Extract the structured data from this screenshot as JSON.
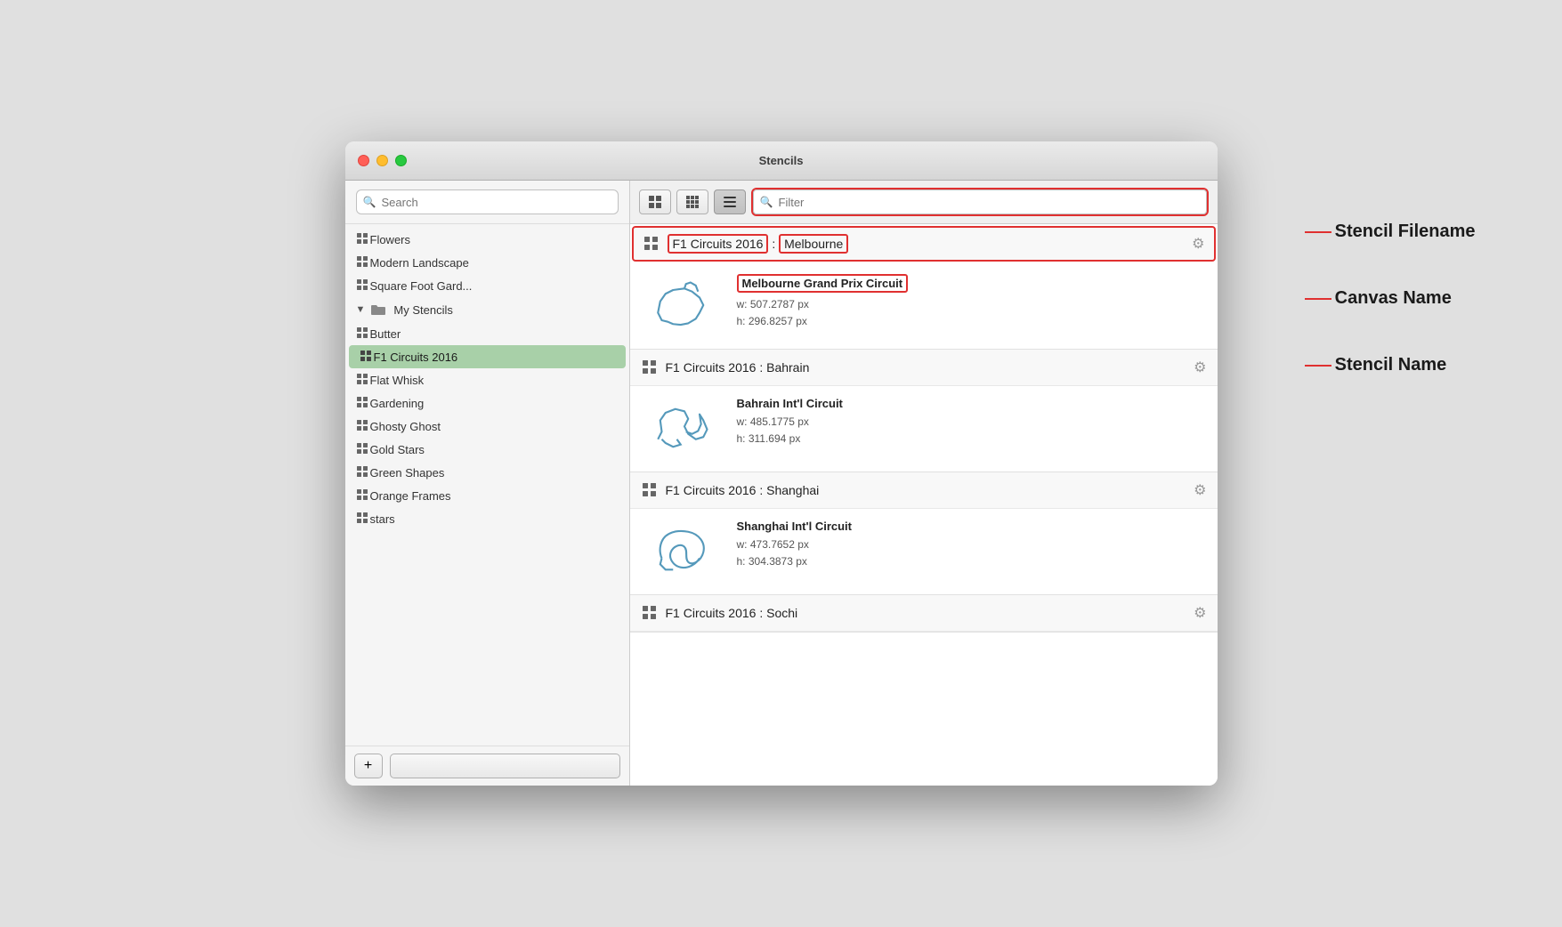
{
  "window": {
    "title": "Stencils"
  },
  "sidebar": {
    "search_placeholder": "Search",
    "items_before_folder": [
      {
        "label": "Flowers"
      },
      {
        "label": "Modern Landscape"
      },
      {
        "label": "Square Foot Gard..."
      }
    ],
    "folder": {
      "label": "My Stencils",
      "items": [
        {
          "label": "Butter",
          "selected": false
        },
        {
          "label": "F1 Circuits 2016",
          "selected": true
        },
        {
          "label": "Flat Whisk",
          "selected": false
        },
        {
          "label": "Gardening",
          "selected": false
        },
        {
          "label": "Ghosty Ghost",
          "selected": false
        },
        {
          "label": "Gold Stars",
          "selected": false
        },
        {
          "label": "Green Shapes",
          "selected": false
        },
        {
          "label": "Orange Frames",
          "selected": false
        },
        {
          "label": "stars",
          "selected": false
        }
      ]
    }
  },
  "toolbar": {
    "filter_placeholder": "Filter"
  },
  "stencil_groups": [
    {
      "id": "melbourne",
      "name_prefix": "F1 Circuits 2016",
      "name_suffix": "Melbourne",
      "highlighted": true,
      "items": [
        {
          "name": "Melbourne Grand Prix Circuit",
          "name_highlighted": true,
          "w": "507.2787 px",
          "h": "296.8257 px"
        }
      ]
    },
    {
      "id": "bahrain",
      "name": "F1 Circuits 2016 : Bahrain",
      "highlighted": false,
      "items": [
        {
          "name": "Bahrain Int'l Circuit",
          "name_highlighted": false,
          "w": "485.1775 px",
          "h": "311.694 px"
        }
      ]
    },
    {
      "id": "shanghai",
      "name": "F1 Circuits 2016 : Shanghai",
      "highlighted": false,
      "items": [
        {
          "name": "Shanghai Int'l Circuit",
          "name_highlighted": false,
          "w": "473.7652 px",
          "h": "304.3873 px"
        }
      ]
    },
    {
      "id": "sochi",
      "name": "F1 Circuits 2016 : Sochi",
      "highlighted": false,
      "items": []
    }
  ],
  "annotations": [
    {
      "label": "Stencil Filename"
    },
    {
      "label": "Canvas Name"
    },
    {
      "label": "Stencil Name"
    }
  ],
  "labels": {
    "w_prefix": "w:",
    "h_prefix": "h:"
  }
}
